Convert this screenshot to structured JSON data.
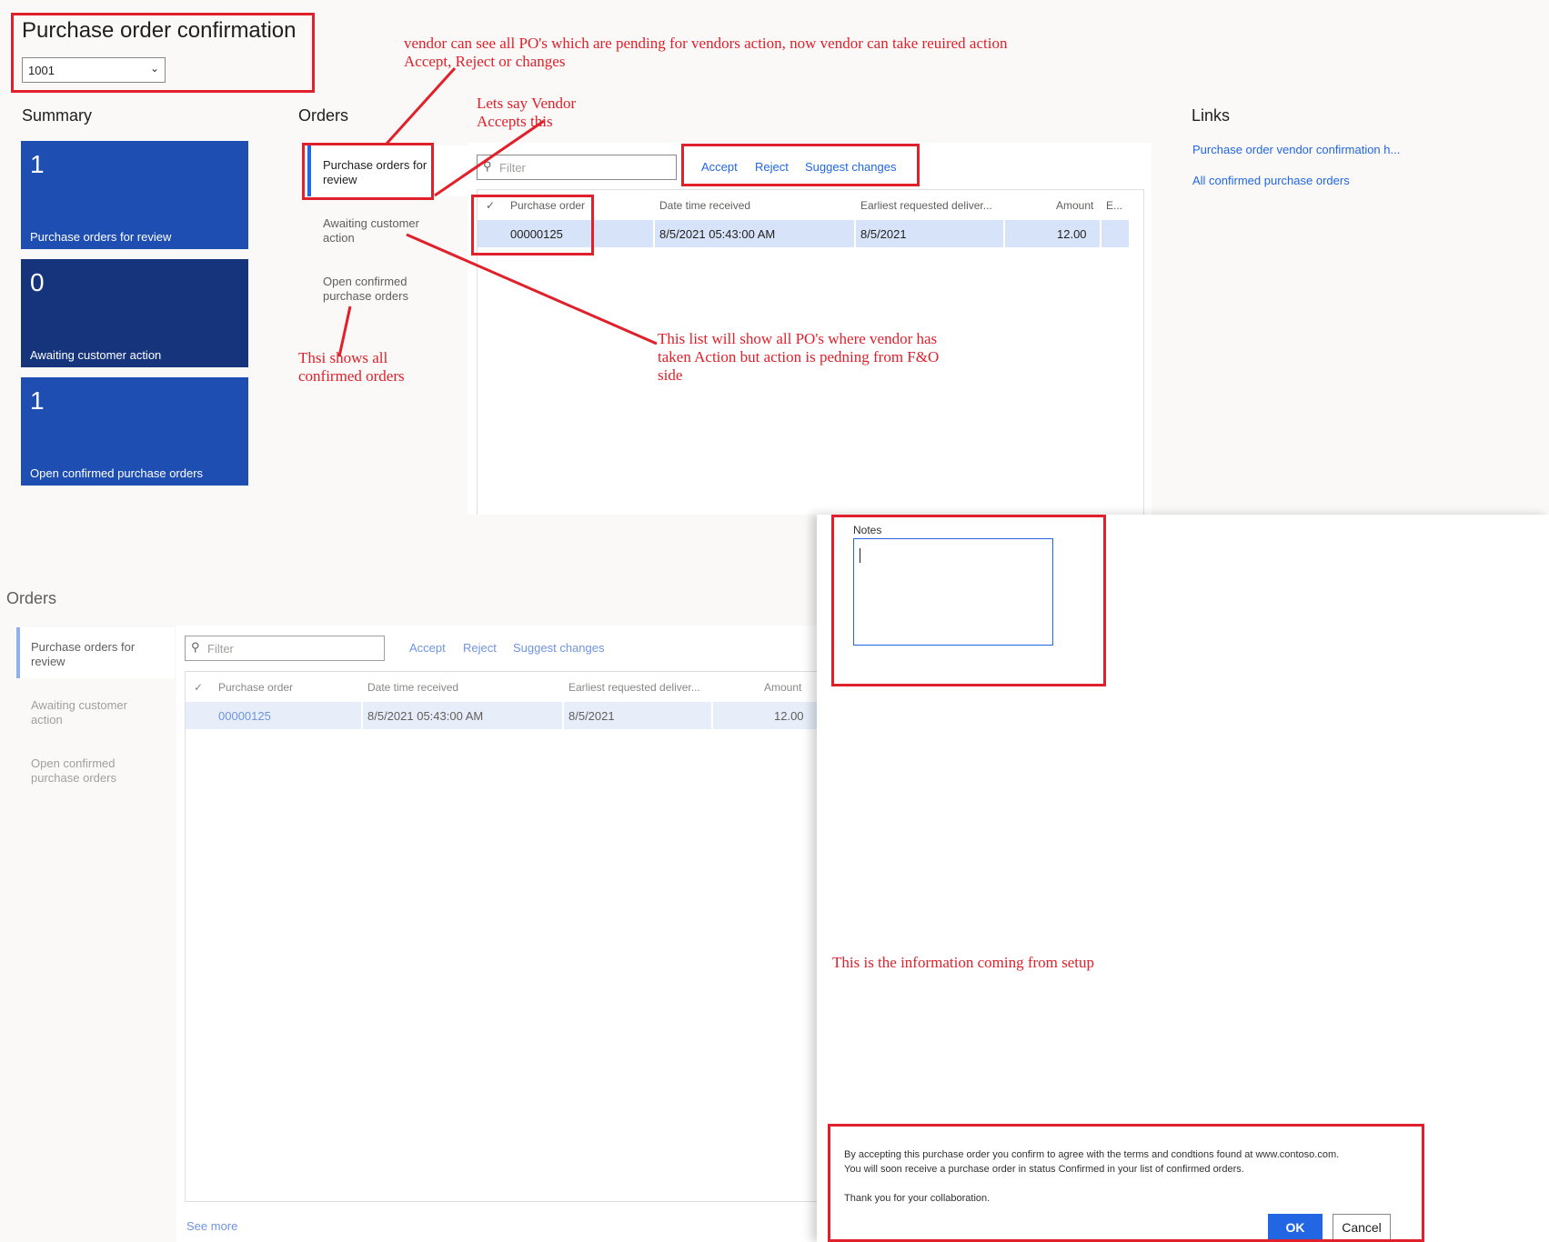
{
  "top": {
    "title": "Purchase order confirmation",
    "vendor_select": {
      "value": "1001"
    },
    "summary": {
      "heading": "Summary",
      "tiles": [
        {
          "count": "1",
          "label": "Purchase orders for review",
          "color": "#1e4eb1"
        },
        {
          "count": "0",
          "label": "Awaiting customer action",
          "color": "#16347c"
        },
        {
          "count": "1",
          "label": "Open confirmed purchase orders",
          "color": "#1e4eb1"
        }
      ]
    },
    "orders": {
      "heading": "Orders",
      "nav": [
        "Purchase orders for review",
        "Awaiting customer action",
        "Open confirmed purchase orders"
      ],
      "filter_placeholder": "Filter",
      "actions": [
        "Accept",
        "Reject",
        "Suggest changes"
      ],
      "columns": [
        "Purchase order",
        "Date time received",
        "Earliest requested deliver...",
        "Amount",
        "E..."
      ],
      "rows": [
        {
          "po": "00000125",
          "received": "8/5/2021 05:43:00 AM",
          "earliest": "8/5/2021",
          "amount": "12.00"
        }
      ]
    },
    "links": {
      "heading": "Links",
      "items": [
        "Purchase order vendor confirmation h...",
        "All confirmed purchase orders"
      ]
    }
  },
  "bottom": {
    "orders_heading": "Orders",
    "nav": [
      "Purchase orders for review",
      "Awaiting customer action",
      "Open confirmed purchase orders"
    ],
    "filter_placeholder": "Filter",
    "actions": [
      "Accept",
      "Reject",
      "Suggest changes"
    ],
    "columns": [
      "Purchase order",
      "Date time received",
      "Earliest requested deliver...",
      "Amount"
    ],
    "rows": [
      {
        "po": "00000125",
        "received": "8/5/2021 05:43:00 AM",
        "earliest": "8/5/2021",
        "amount": "12.00"
      }
    ],
    "see_more": "See more"
  },
  "dialog": {
    "notes_label": "Notes",
    "terms_line1": "By accepting this purchase order you confirm to agree with the terms and condtions found at www.contoso.com.",
    "terms_line2": "You will soon receive a purchase order in status Confirmed in your list of confirmed orders.",
    "terms_line3": "Thank you for your collaboration.",
    "ok_label": "OK",
    "cancel_label": "Cancel"
  },
  "annotations": {
    "vendor_can_see": "vendor can see all PO's which are pending for vendors action, now vendor can take reuired action Accept, Reject or changes",
    "lets_say": "Lets say Vendor Accepts this",
    "list_will_show": "This list will show all PO's where vendor has taken Action but action is pedning from F&O side",
    "thsi_shows": "Thsi shows all confirmed orders",
    "info_setup": "This is the information coming from setup"
  },
  "colors": {
    "accent": "#2266e3",
    "annotation_red": "#e0202a",
    "tile_dark": "#16347c",
    "tile_blue": "#1e4eb1"
  }
}
